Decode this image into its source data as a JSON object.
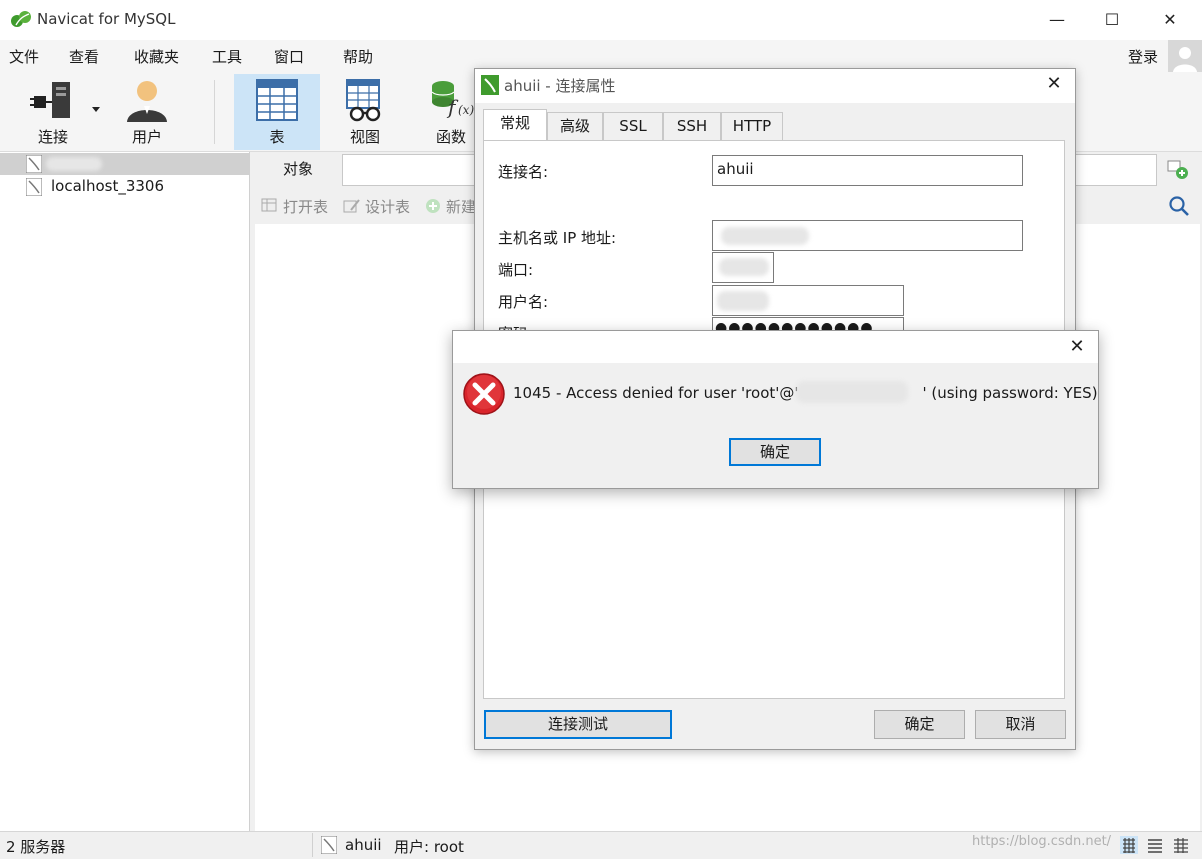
{
  "window": {
    "title": "Navicat for MySQL",
    "controls": {
      "minimize": "—",
      "maximize": "☐",
      "close": "✕"
    }
  },
  "menu": {
    "items": [
      "文件",
      "查看",
      "收藏夹",
      "工具",
      "窗口",
      "帮助"
    ],
    "login": "登录"
  },
  "toolbar": {
    "connect": "连接",
    "user": "用户",
    "table": "表",
    "view": "视图",
    "function": "函数"
  },
  "sidebar": {
    "connections": [
      {
        "label": "",
        "selected": true
      },
      {
        "label": "localhost_3306",
        "selected": false
      }
    ]
  },
  "object_panel": {
    "tab": "对象",
    "actions": [
      "打开表",
      "设计表",
      "新建"
    ]
  },
  "status": {
    "count": "2 服务器",
    "connection": "ahuii",
    "user": "用户: root",
    "watermark": "https://blog.csdn.net/"
  },
  "conn_dialog": {
    "title": "ahuii - 连接属性",
    "tabs": [
      "常规",
      "高级",
      "SSL",
      "SSH",
      "HTTP"
    ],
    "active_tab": "常规",
    "fields": {
      "conn_name_label": "连接名:",
      "conn_name_value": "ahuii",
      "host_label": "主机名或 IP 地址:",
      "port_label": "端口:",
      "user_label": "用户名:",
      "password_label": "密码",
      "password_value": "●●●●●●●●●●●●"
    },
    "buttons": {
      "test": "连接测试",
      "ok": "确定",
      "cancel": "取消"
    }
  },
  "error_dialog": {
    "message": "1045 - Access denied for user 'root'@'                          ' (using password: YES)",
    "ok": "确定"
  },
  "colors": {
    "accent": "#0078d7",
    "selection": "#cce4f7",
    "error_red": "#d9242b",
    "navicat_green": "#3f9b2d"
  }
}
